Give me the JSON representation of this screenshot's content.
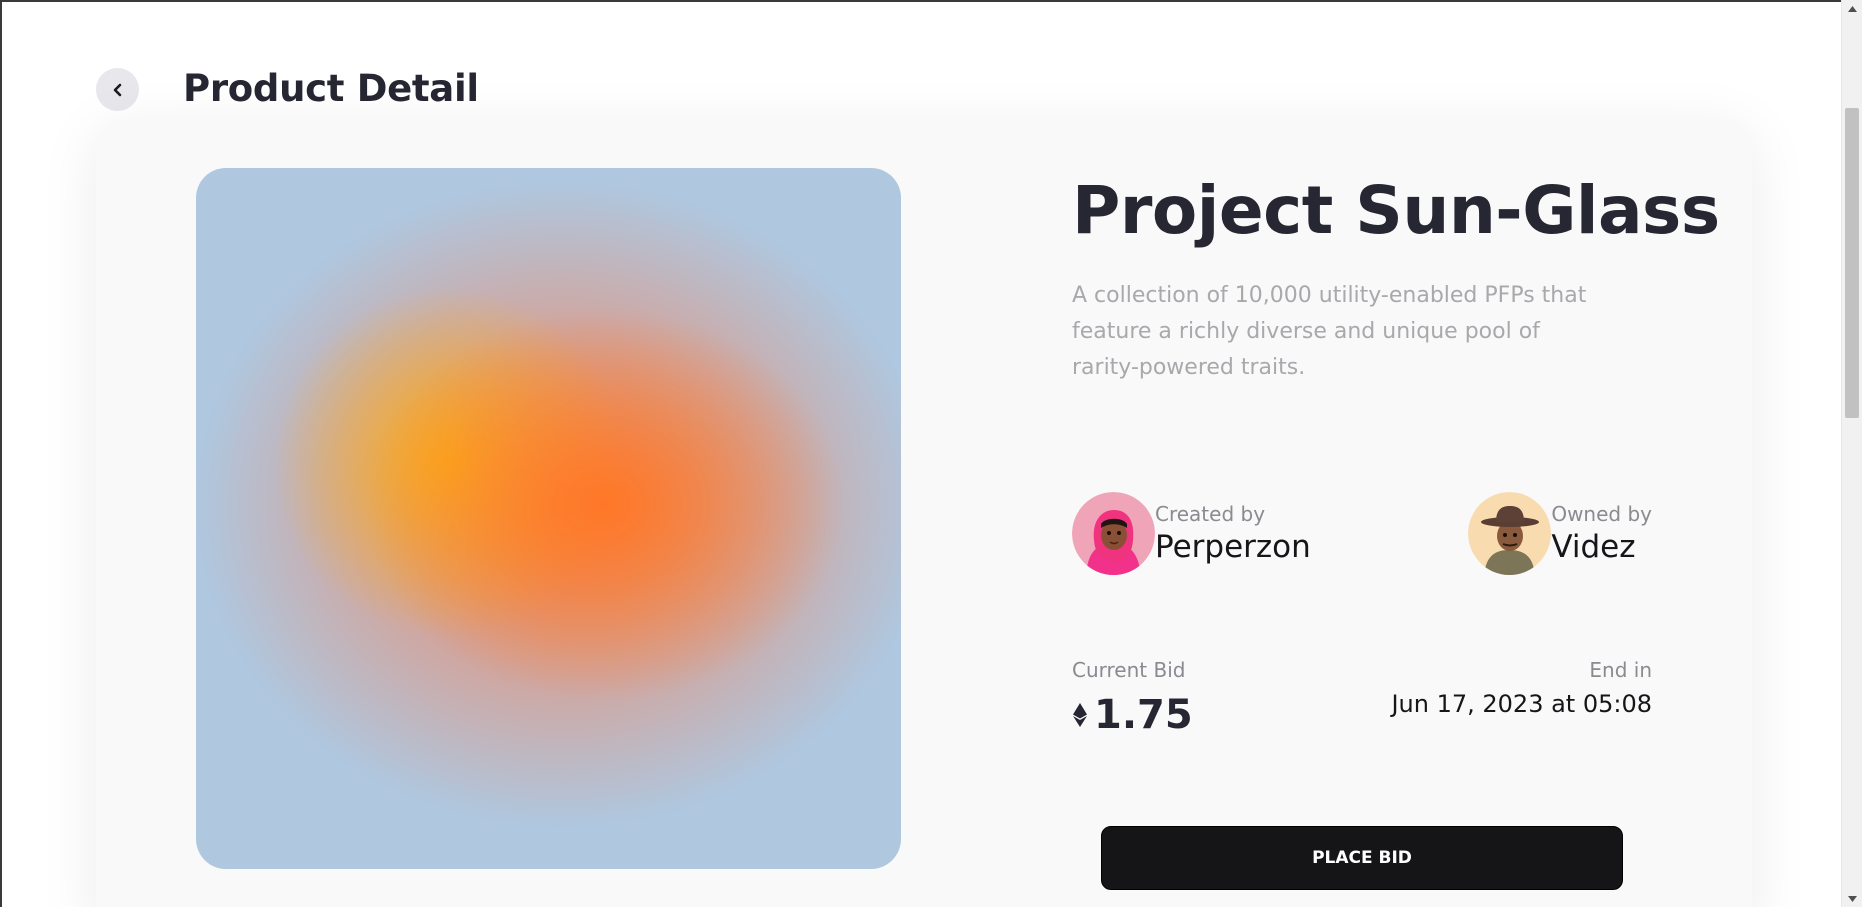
{
  "header": {
    "title": "Product Detail",
    "back_icon": "chevron-left-icon"
  },
  "product": {
    "title": "Project Sun-Glass",
    "description": "A collection of 10,000 utility-enabled PFPs that feature a richly diverse and unique pool of rarity-powered traits."
  },
  "creator": {
    "label": "Created by",
    "name": "Perperzon",
    "avatar_bg": "#ec5b9a"
  },
  "owner": {
    "label": "Owned by",
    "name": "Videz",
    "avatar_bg": "#f7d9a8"
  },
  "bid": {
    "label": "Current Bid",
    "value": "1.75",
    "currency_icon": "ethereum-icon"
  },
  "end": {
    "label": "End in",
    "value": "Jun 17, 2023 at 05:08"
  },
  "actions": {
    "place_bid": "PLACE BID"
  },
  "colors": {
    "text_primary": "#262732",
    "text_muted": "#a8a8ad",
    "button_bg": "#151518",
    "card_bg": "#f9f9f9"
  }
}
